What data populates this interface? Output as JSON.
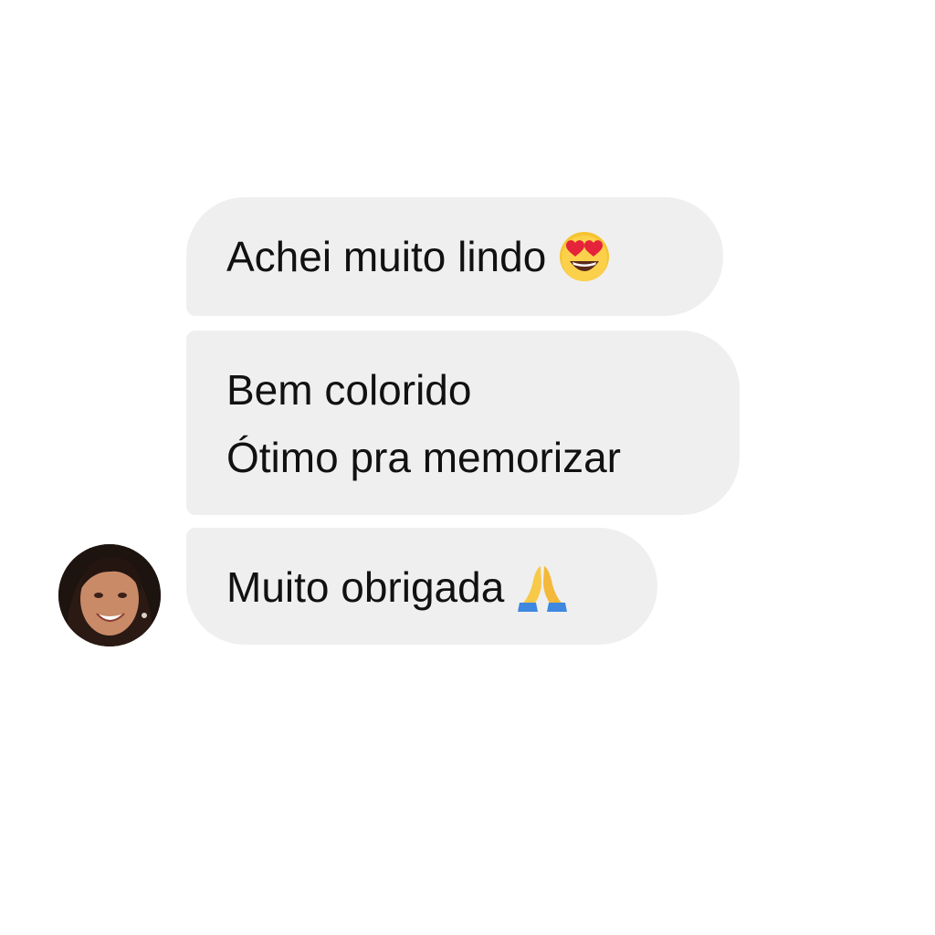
{
  "messages": [
    {
      "text": "Achei muito lindo",
      "emoji": "smiling-face-with-heart-eyes-icon"
    },
    {
      "lines": [
        "Bem colorido",
        "Ótimo pra memorizar"
      ]
    },
    {
      "text": "Muito obrigada",
      "emoji": "folded-hands-icon"
    }
  ],
  "colors": {
    "background": "#ffffff",
    "bubble": "#efefef",
    "text": "#111111"
  }
}
